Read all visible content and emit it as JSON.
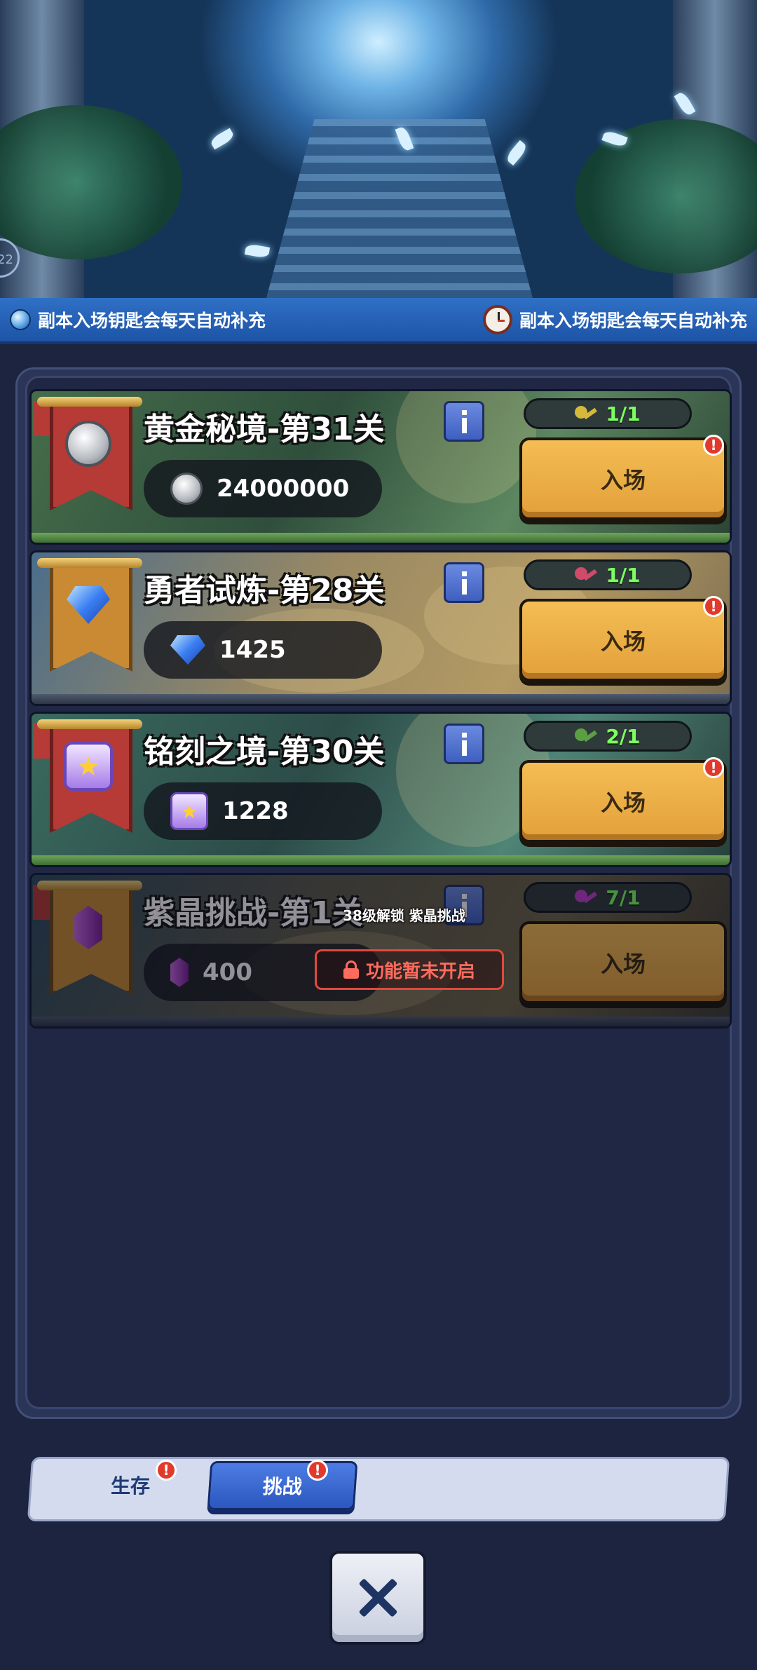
{
  "notice": {
    "left_text": "副本入场钥匙会每天自动补充",
    "right_text": "副本入场钥匙会每天自动补充",
    "edge_timer": "22"
  },
  "dungeons": [
    {
      "title": "黄金秘境-第31关",
      "reward": "24000000",
      "keys": "1/1",
      "enter_label": "入场",
      "alert": "!"
    },
    {
      "title": "勇者试炼-第28关",
      "reward": "1425",
      "keys": "1/1",
      "enter_label": "入场",
      "alert": "!"
    },
    {
      "title": "铭刻之境-第30关",
      "reward": "1228",
      "keys": "2/1",
      "enter_label": "入场",
      "alert": "!"
    },
    {
      "title": "紫晶挑战-第1关",
      "reward": "400",
      "keys": "7/1",
      "enter_label": "入场",
      "unlock_text": "38级解锁  紫晶挑战",
      "locked_label": "功能暂未开启"
    }
  ],
  "tabs": {
    "survival": "生存",
    "challenge": "挑战",
    "alert": "!"
  },
  "colors": {
    "enter_button": "#f4bd54",
    "tab_active": "#3f6bd6",
    "key_count": "#7dff62",
    "lock_red": "#e04a3d"
  }
}
